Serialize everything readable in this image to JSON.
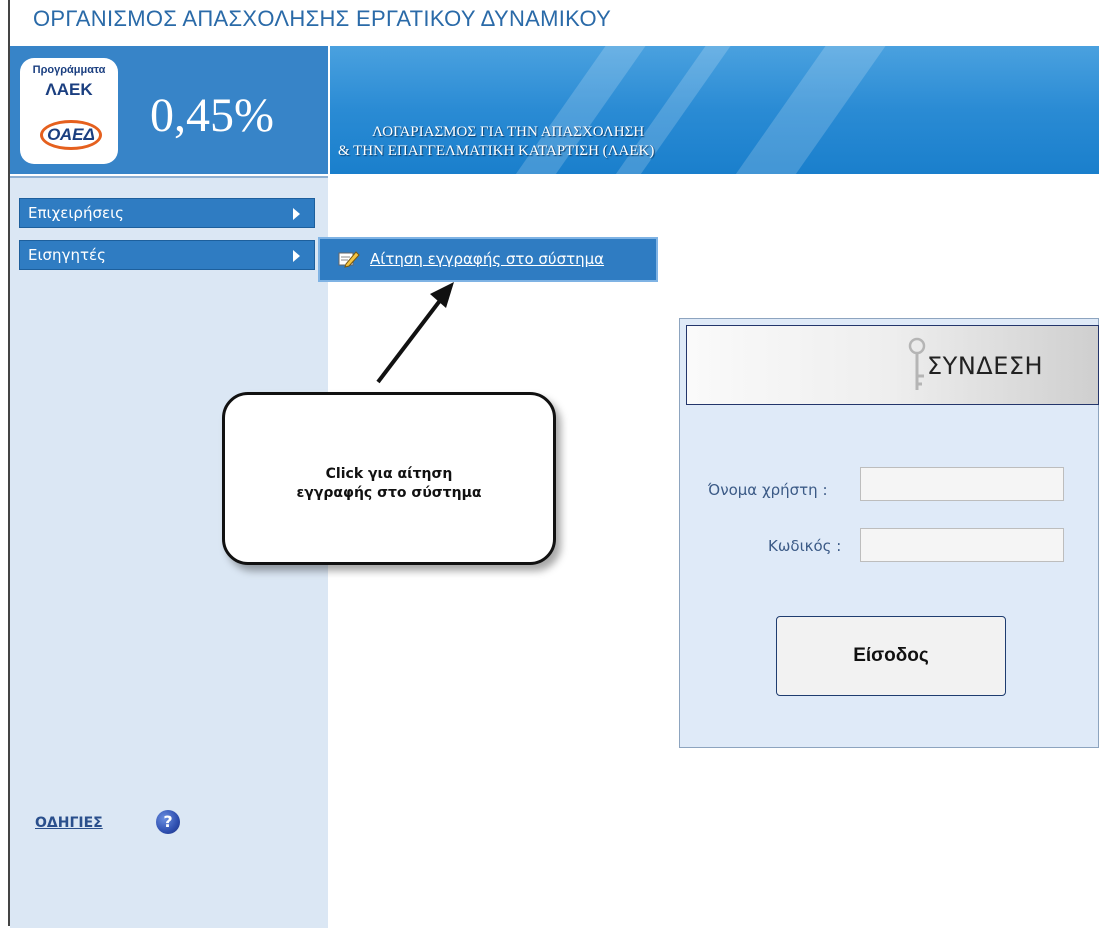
{
  "header": {
    "org_title": "ΟΡΓΑΝΙΣΜΟΣ ΑΠΑΣΧΟΛΗΣΗΣ ΕΡΓΑΤΙΚΟΥ ΔΥΝΑΜΙΚΟΥ",
    "logo_top": "Προγράμματα",
    "logo_main": "ΛΑΕΚ",
    "logo_oval": "ΟΑΕΔ",
    "percentage": "0,45%",
    "account_line1": "ΛΟΓΑΡΙΑΣΜΟΣ ΓΙΑ ΤΗΝ ΑΠΑΣΧΟΛΗΣΗ",
    "account_line2": "& ΤΗΝ ΕΠΑΓΓΕΛΜΑΤΙΚΗ ΚΑΤΑΡΤΙΣΗ (ΛΑΕΚ)"
  },
  "sidebar": {
    "items": [
      {
        "label": "Επιχειρήσεις"
      },
      {
        "label": "Εισηγητές"
      }
    ],
    "submenu_label": "Αίτηση εγγραφής στο σύστημα",
    "help_label": "ΟΔΗΓΙΕΣ",
    "help_icon_glyph": "?"
  },
  "callout": {
    "line1": "Click για αίτηση",
    "line2": "εγγραφής στο σύστημα"
  },
  "login": {
    "title": "ΣΥΝΔΕΣΗ",
    "username_label": "Όνομα χρήστη :",
    "username_value": "",
    "password_label": "Κωδικός :",
    "password_value": "",
    "submit_label": "Είσοδος"
  },
  "colors": {
    "menu_blue": "#2f7cc2",
    "sidebar_bg": "#dbe7f4",
    "title_blue": "#2a6aa8"
  }
}
